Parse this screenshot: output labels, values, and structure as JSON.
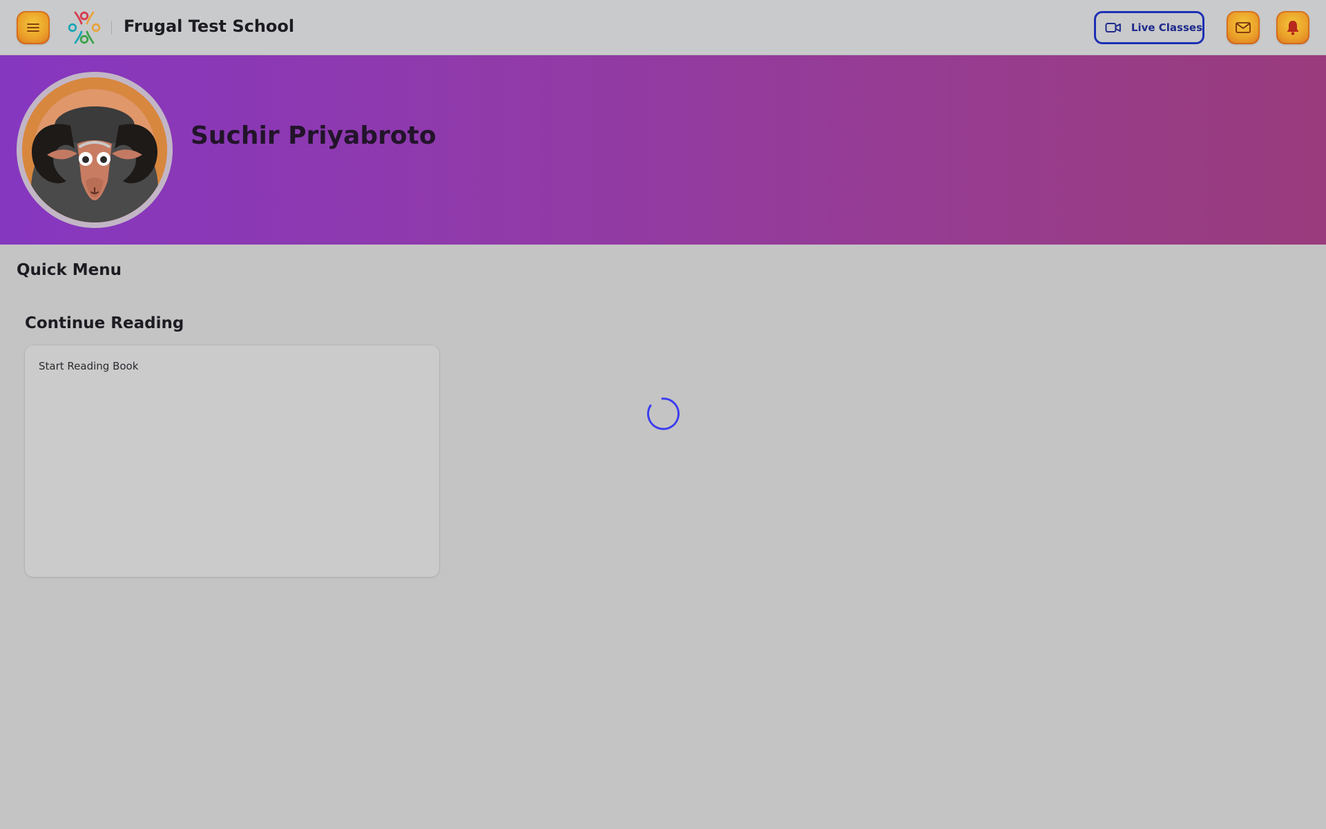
{
  "header": {
    "school_name": "Frugal Test School",
    "live_classes_label": "Live Classes",
    "menu_icon": "hamburger-menu-icon",
    "mail_icon": "mail-icon",
    "bell_icon": "bell-icon",
    "video_icon": "video-camera-icon"
  },
  "profile": {
    "student_name": "Suchir Priyabroto",
    "avatar_icon": "ram-avatar"
  },
  "quick_menu": {
    "title": "Quick Menu"
  },
  "continue_reading": {
    "title": "Continue Reading",
    "card_text": "Start Reading Book"
  },
  "loading": {
    "spinner_icon": "loading-spinner-icon"
  },
  "colors": {
    "accent_orange": "#eba12a",
    "live_button_blue": "#1d2fb4",
    "banner_start": "#8637c0",
    "banner_end": "#993b7c",
    "spinner_blue": "#3b3df0"
  }
}
